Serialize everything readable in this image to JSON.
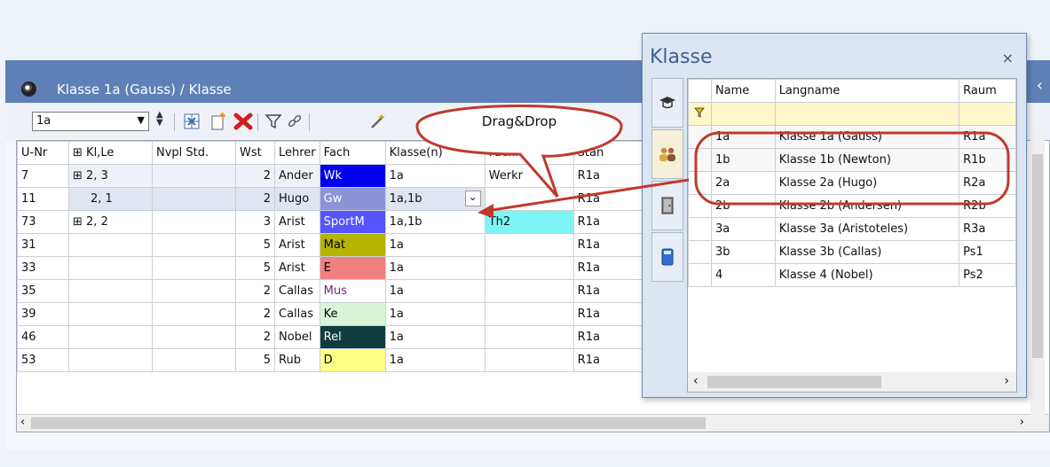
{
  "window": {
    "title": "Klasse 1a (Gauss) / Klasse",
    "collapse_glyph": "‹",
    "toolbar": {
      "class_value": "1a",
      "icons": [
        "grid-insert-icon",
        "new-document-icon",
        "delete-icon",
        "filter-icon",
        "link-icon",
        "magic-wand-icon"
      ]
    }
  },
  "grid": {
    "columns": [
      "U-Nr",
      "Kl,Le",
      "Nvpl Std.",
      "Wst",
      "Lehrer",
      "Fach",
      "Klasse(n)",
      "Fachraum",
      "Stan"
    ],
    "rows": [
      {
        "unr": "7",
        "klle": "2, 3",
        "nvpl": "",
        "wst": "2",
        "lehrer": "Ander",
        "fach": "Wk",
        "fach_bg": "#0000ee",
        "fach_fg": "#ffffff",
        "klassen": "1a",
        "fachraum": "Werkr",
        "fachraum_bg": "",
        "stan": "R1a"
      },
      {
        "unr": "11",
        "klle": "2, 1",
        "nvpl": "",
        "wst": "2",
        "lehrer": "Hugo",
        "fach": "Gw",
        "fach_bg": "#8b94d6",
        "fach_fg": "#ffffff",
        "klassen": "1a,1b",
        "fachraum": "",
        "fachraum_bg": "",
        "stan": "R1a"
      },
      {
        "unr": "73",
        "klle": "2, 2",
        "nvpl": "",
        "wst": "3",
        "lehrer": "Arist",
        "fach": "SportM",
        "fach_bg": "#5555ff",
        "fach_fg": "#ffffff",
        "klassen": "1a,1b",
        "fachraum": "Th2",
        "fachraum_bg": "#7ef5f5",
        "stan": "R1a"
      },
      {
        "unr": "31",
        "klle": "",
        "nvpl": "",
        "wst": "5",
        "lehrer": "Arist",
        "fach": "Mat",
        "fach_bg": "#b5b500",
        "fach_fg": "#000000",
        "klassen": "1a",
        "fachraum": "",
        "fachraum_bg": "",
        "stan": "R1a"
      },
      {
        "unr": "33",
        "klle": "",
        "nvpl": "",
        "wst": "5",
        "lehrer": "Arist",
        "fach": "E",
        "fach_bg": "#f08080",
        "fach_fg": "#000000",
        "klassen": "1a",
        "fachraum": "",
        "fachraum_bg": "",
        "stan": "R1a"
      },
      {
        "unr": "35",
        "klle": "",
        "nvpl": "",
        "wst": "2",
        "lehrer": "Callas",
        "fach": "Mus",
        "fach_bg": "#ffffff",
        "fach_fg": "#7a1f7a",
        "klassen": "1a",
        "fachraum": "",
        "fachraum_bg": "",
        "stan": "R1a"
      },
      {
        "unr": "39",
        "klle": "",
        "nvpl": "",
        "wst": "2",
        "lehrer": "Callas",
        "fach": "Ke",
        "fach_bg": "#d8f5d8",
        "fach_fg": "#000000",
        "klassen": "1a",
        "fachraum": "",
        "fachraum_bg": "",
        "stan": "R1a"
      },
      {
        "unr": "46",
        "klle": "",
        "nvpl": "",
        "wst": "2",
        "lehrer": "Nobel",
        "fach": "Rel",
        "fach_bg": "#0f3d3d",
        "fach_fg": "#ffffff",
        "klassen": "1a",
        "fachraum": "",
        "fachraum_bg": "",
        "stan": "R1a"
      },
      {
        "unr": "53",
        "klle": "",
        "nvpl": "",
        "wst": "5",
        "lehrer": "Rub",
        "fach": "D",
        "fach_bg": "#ffff88",
        "fach_fg": "#000000",
        "klassen": "1a",
        "fachraum": "",
        "fachraum_bg": "",
        "stan": "R1a"
      }
    ],
    "scroll_left": "‹",
    "scroll_right": "›"
  },
  "callout": {
    "text": "Drag&Drop"
  },
  "popup": {
    "title": "Klasse",
    "close": "×",
    "columns": [
      "Name",
      "Langname",
      "Raum"
    ],
    "rows": [
      {
        "name": "1a",
        "langname": "Klasse 1a (Gauss)",
        "raum": "R1a"
      },
      {
        "name": "1b",
        "langname": "Klasse 1b (Newton)",
        "raum": "R1b"
      },
      {
        "name": "2a",
        "langname": "Klasse 2a (Hugo)",
        "raum": "R2a"
      },
      {
        "name": "2b",
        "langname": "Klasse 2b (Andersen)",
        "raum": "R2b"
      },
      {
        "name": "3a",
        "langname": "Klasse 3a (Aristoteles)",
        "raum": "R3a"
      },
      {
        "name": "3b",
        "langname": "Klasse 3b (Callas)",
        "raum": "Ps1"
      },
      {
        "name": "4",
        "langname": "Klasse 4 (Nobel)",
        "raum": "Ps2"
      }
    ],
    "side_icons": [
      "graduation-cap-icon",
      "people-icon",
      "door-icon",
      "book-icon"
    ],
    "scroll_left": "‹",
    "scroll_right": "›"
  },
  "colors": {
    "title_bar": "#5f80b6",
    "highlight_red": "#c0392b",
    "filter_row": "#fff6cc"
  }
}
